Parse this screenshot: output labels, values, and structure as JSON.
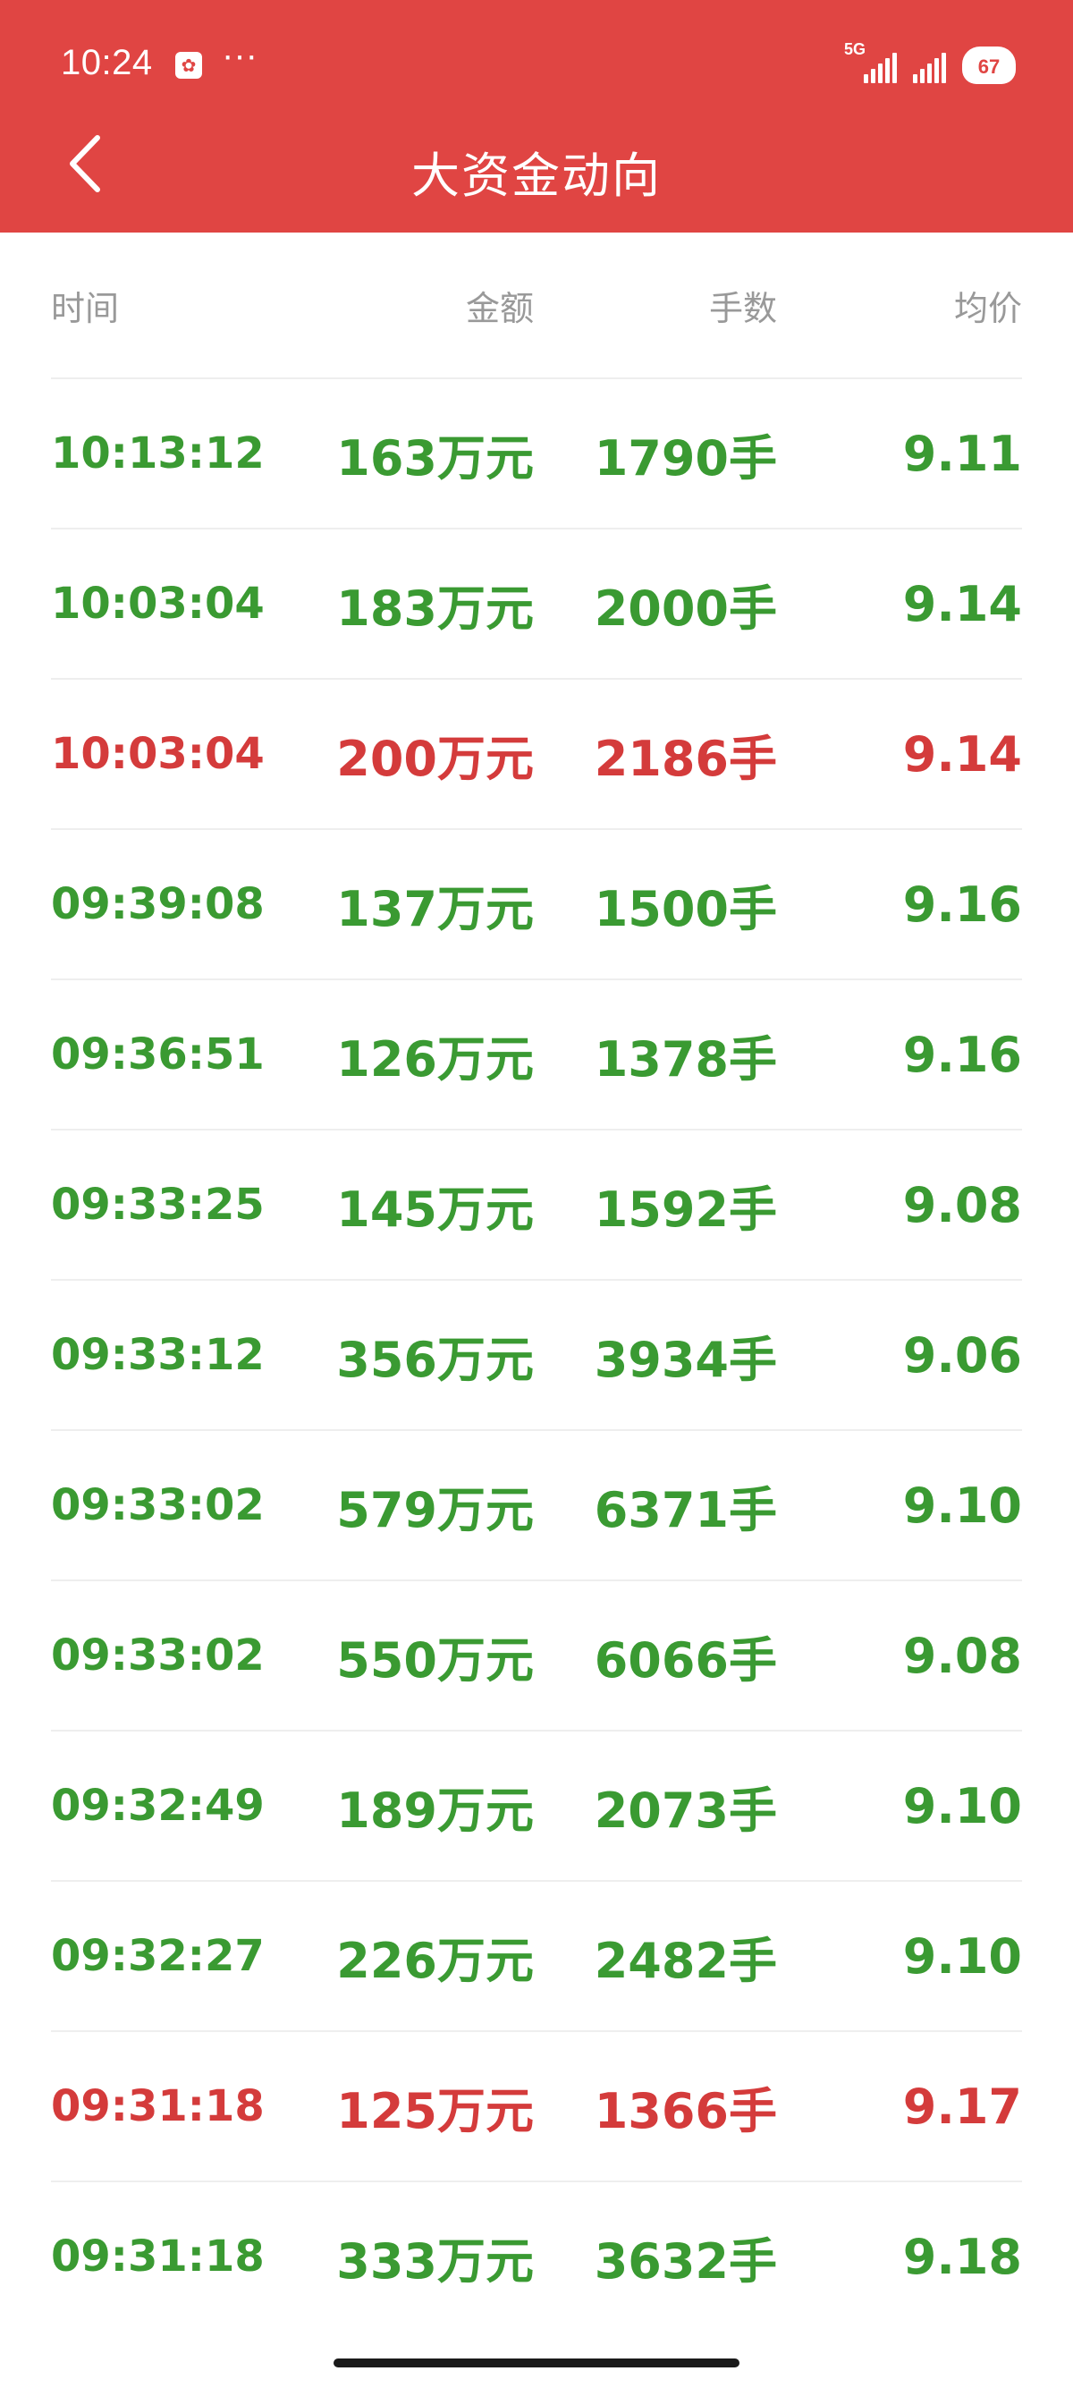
{
  "status_bar": {
    "time": "10:24",
    "more": "···",
    "signal_label": "5G",
    "battery": "67"
  },
  "header": {
    "title": "大资金动向"
  },
  "colors": {
    "header_bg": "#e04543",
    "up_red": "#d43b3b",
    "down_green": "#3a9a32",
    "header_text_gray": "#999999",
    "divider": "#eeeeee"
  },
  "table": {
    "columns": [
      "时间",
      "金额",
      "手数",
      "均价"
    ],
    "rows": [
      {
        "time": "10:13:12",
        "amount": "163万元",
        "lots": "1790手",
        "price": "9.11",
        "direction": "down"
      },
      {
        "time": "10:03:04",
        "amount": "183万元",
        "lots": "2000手",
        "price": "9.14",
        "direction": "down"
      },
      {
        "time": "10:03:04",
        "amount": "200万元",
        "lots": "2186手",
        "price": "9.14",
        "direction": "up"
      },
      {
        "time": "09:39:08",
        "amount": "137万元",
        "lots": "1500手",
        "price": "9.16",
        "direction": "down"
      },
      {
        "time": "09:36:51",
        "amount": "126万元",
        "lots": "1378手",
        "price": "9.16",
        "direction": "down"
      },
      {
        "time": "09:33:25",
        "amount": "145万元",
        "lots": "1592手",
        "price": "9.08",
        "direction": "down"
      },
      {
        "time": "09:33:12",
        "amount": "356万元",
        "lots": "3934手",
        "price": "9.06",
        "direction": "down"
      },
      {
        "time": "09:33:02",
        "amount": "579万元",
        "lots": "6371手",
        "price": "9.10",
        "direction": "down"
      },
      {
        "time": "09:33:02",
        "amount": "550万元",
        "lots": "6066手",
        "price": "9.08",
        "direction": "down"
      },
      {
        "time": "09:32:49",
        "amount": "189万元",
        "lots": "2073手",
        "price": "9.10",
        "direction": "down"
      },
      {
        "time": "09:32:27",
        "amount": "226万元",
        "lots": "2482手",
        "price": "9.10",
        "direction": "down"
      },
      {
        "time": "09:31:18",
        "amount": "125万元",
        "lots": "1366手",
        "price": "9.17",
        "direction": "up"
      },
      {
        "time": "09:31:18",
        "amount": "333万元",
        "lots": "3632手",
        "price": "9.18",
        "direction": "down"
      }
    ]
  },
  "icons": {
    "back": "chevron-left-icon",
    "app": "app-notification-icon",
    "signal": "signal-icon",
    "battery": "battery-icon"
  }
}
